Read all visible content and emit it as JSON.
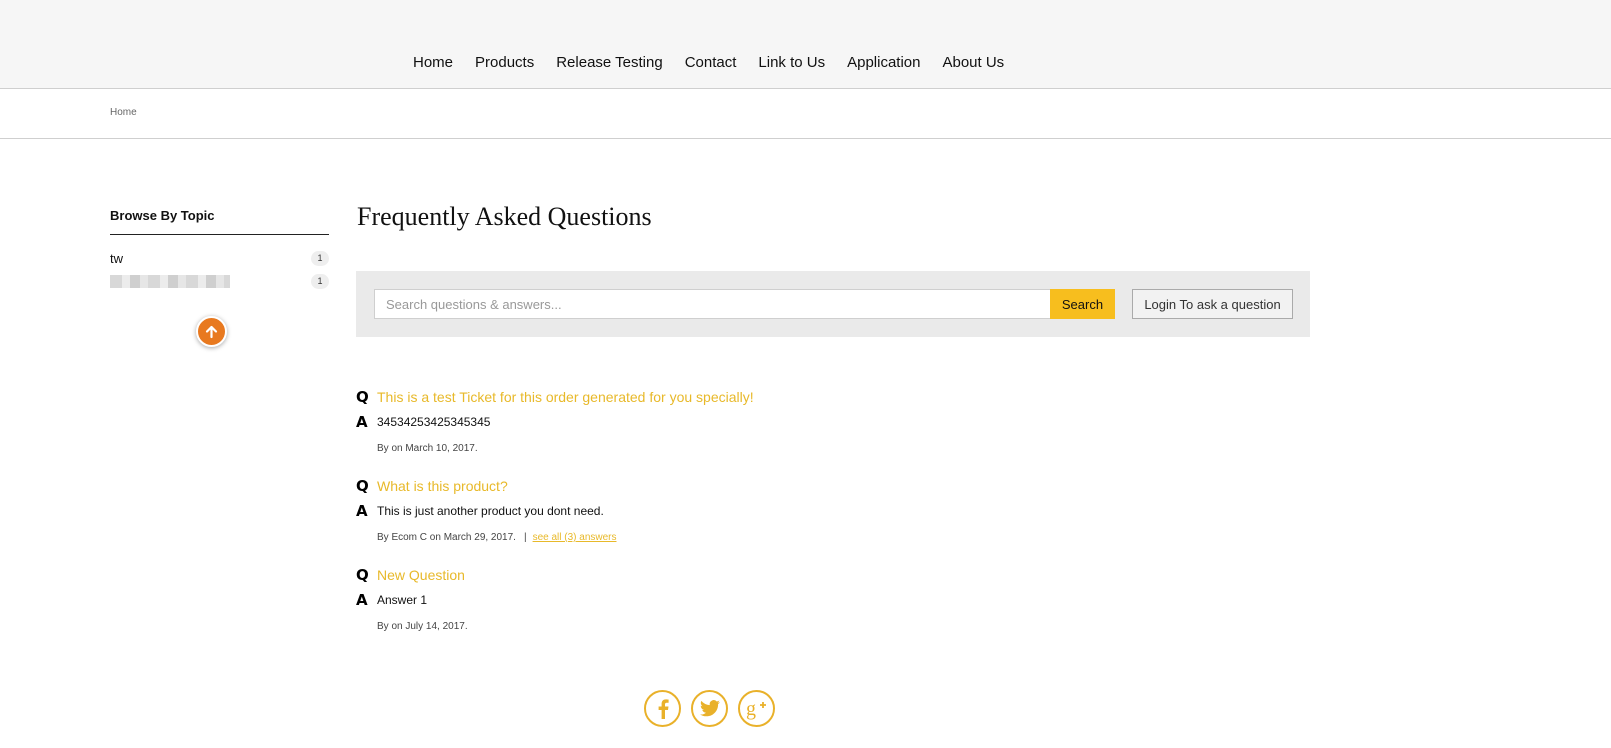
{
  "nav": {
    "items": [
      "Home",
      "Products",
      "Release Testing",
      "Contact",
      "Link to Us",
      "Application",
      "About Us"
    ]
  },
  "breadcrumb": {
    "home": "Home"
  },
  "sidebar": {
    "title": "Browse By Topic",
    "topics": [
      {
        "name": "tw",
        "count": "1"
      },
      {
        "name": "",
        "count": "1"
      }
    ]
  },
  "faq": {
    "title": "Frequently Asked Questions",
    "search": {
      "placeholder": "Search questions & answers...",
      "value": "",
      "button": "Search"
    },
    "login_button": "Login To ask a question",
    "q_mark": "Q",
    "a_mark": "A",
    "items": [
      {
        "question": "This is a test Ticket for this order generated for you specially!",
        "answer": "34534253425345345",
        "meta": "By on March 10, 2017."
      },
      {
        "question": "What is this product?",
        "answer": "This is just another product you dont need.",
        "meta": "By Ecom C on March 29, 2017.",
        "separator": "|",
        "see_all": "see all (3) answers"
      },
      {
        "question": "New Question",
        "answer": "Answer 1",
        "meta": "By on July 14, 2017."
      }
    ]
  },
  "social": {
    "icons": [
      "facebook-icon",
      "twitter-icon",
      "google-plus-icon"
    ]
  },
  "colors": {
    "accent": "#f7be1e",
    "link": "#e8b92a",
    "scroll_button": "#e8791f",
    "topbar_bg": "#f6f6f6"
  }
}
